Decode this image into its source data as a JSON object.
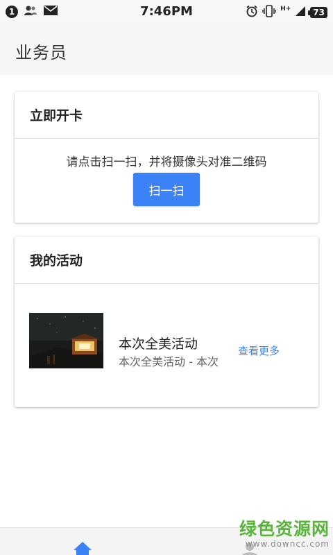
{
  "status_bar": {
    "notification_count": "1",
    "time": "7:46PM",
    "network_label": "H+",
    "battery": "73",
    "icons": [
      "person-icon",
      "mail-icon",
      "alarm-icon",
      "vibrate-icon",
      "signal-icon"
    ]
  },
  "header": {
    "title": "业务员"
  },
  "open_card": {
    "title": "立即开卡",
    "hint": "请点击扫一扫，并将摄像头对准二维码",
    "scan_button": "扫一扫"
  },
  "activities": {
    "title": "我的活动",
    "items": [
      {
        "title": "本次全美活动",
        "subtitle": "本次全美活动 - 本次",
        "more_label": "查看更多"
      }
    ]
  },
  "bottom_nav": {
    "items": [
      "home-icon",
      "user-icon"
    ]
  },
  "watermark": {
    "cn": "绿色资源网",
    "url": "www.downcc.com"
  },
  "colors": {
    "accent": "#3b82f6",
    "watermark_green": "#5ab43c"
  }
}
